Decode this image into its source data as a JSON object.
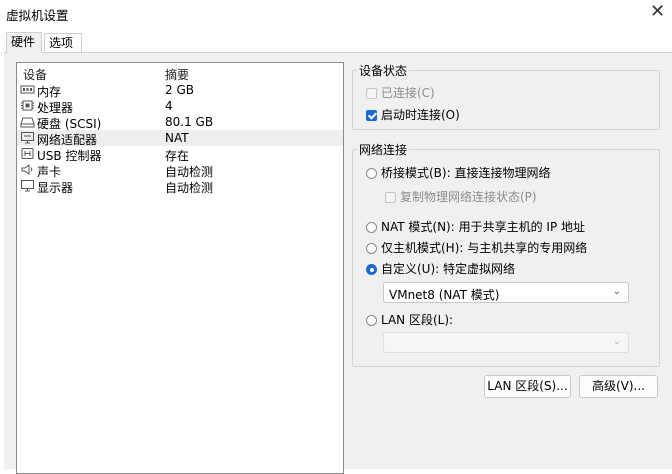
{
  "window": {
    "title": "虚拟机设置",
    "close_glyph": "✕"
  },
  "tabs": [
    {
      "label": "硬件"
    },
    {
      "label": "选项"
    }
  ],
  "device_list": {
    "headers": {
      "device": "设备",
      "summary": "摘要"
    },
    "rows": [
      {
        "name": "内存",
        "summary": "2 GB",
        "icon": "memory-icon"
      },
      {
        "name": "处理器",
        "summary": "4",
        "icon": "processor-icon"
      },
      {
        "name": "硬盘 (SCSI)",
        "summary": "80.1 GB",
        "icon": "hard-disk-icon"
      },
      {
        "name": "网络适配器",
        "summary": "NAT",
        "icon": "network-adapter-icon"
      },
      {
        "name": "USB 控制器",
        "summary": "存在",
        "icon": "usb-icon"
      },
      {
        "name": "声卡",
        "summary": "自动检测",
        "icon": "speaker-icon"
      },
      {
        "name": "显示器",
        "summary": "自动检测",
        "icon": "monitor-icon"
      }
    ],
    "selected_index": 3
  },
  "device_status": {
    "title": "设备状态",
    "connected": {
      "label": "已连接(C)",
      "checked": false,
      "enabled": false
    },
    "connect_at_power_on": {
      "label": "启动时连接(O)",
      "checked": true,
      "enabled": true
    }
  },
  "network_connection": {
    "title": "网络连接",
    "bridged": {
      "label": "桥接模式(B): 直接连接物理网络",
      "selected": false
    },
    "replicate": {
      "label": "复制物理网络连接状态(P)",
      "checked": false,
      "enabled": false
    },
    "nat": {
      "label": "NAT 模式(N): 用于共享主机的 IP 地址",
      "selected": false
    },
    "host_only": {
      "label": "仅主机模式(H): 与主机共享的专用网络",
      "selected": false
    },
    "custom": {
      "label": "自定义(U): 特定虚拟网络",
      "selected": true
    },
    "custom_select_value": "VMnet8 (NAT 模式)",
    "lan_segment": {
      "label": "LAN 区段(L):",
      "selected": false
    },
    "lan_select_value": ""
  },
  "buttons": {
    "lan_segments": "LAN 区段(S)...",
    "advanced": "高级(V)..."
  },
  "colors": {
    "accent": "#1a6bd0",
    "selection_bg": "#eeeeee",
    "panel_bg": "#f0f0f0"
  }
}
